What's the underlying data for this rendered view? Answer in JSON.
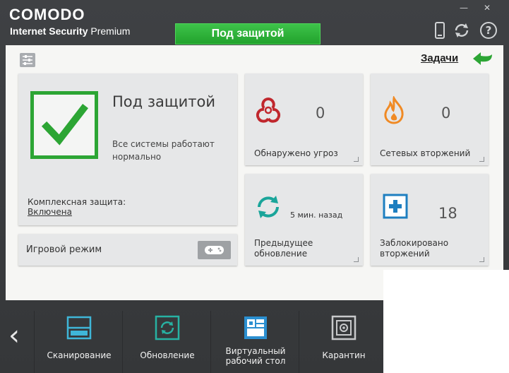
{
  "header": {
    "brand": "COMODO",
    "product_bold": "Internet Security",
    "product_edition": "Premium",
    "status": "Под защитой",
    "minimize": "—",
    "close": "✕"
  },
  "toolbar": {
    "tasks_label": "Задачи"
  },
  "protection": {
    "title": "Под защитой",
    "description": "Все системы работают нормально",
    "complex_label": "Комплексная защита:",
    "complex_status": "Включена"
  },
  "game_mode": {
    "label": "Игровой режим"
  },
  "stats": {
    "threats": {
      "value": "0",
      "label": "Обнаружено угроз"
    },
    "intrusions": {
      "value": "0",
      "label": "Сетевых вторжений"
    },
    "update": {
      "time": "5 мин. назад",
      "label_line1": "Предыдущее",
      "label_line2": "обновление"
    },
    "blocked": {
      "value": "18",
      "label_line1": "Заблокировано",
      "label_line2": "вторжений"
    }
  },
  "dock": {
    "scan": "Сканирование",
    "update": "Обновление",
    "vdesk_line1": "Виртуальный",
    "vdesk_line2": "рабочий стол",
    "quarantine": "Карантин"
  },
  "colors": {
    "accent_green": "#2ca534",
    "banner_green": "#22a22c",
    "threat_red": "#c0272d",
    "fire_orange": "#f08a24",
    "update_teal": "#1aa59a",
    "block_blue": "#1e7fc0"
  }
}
